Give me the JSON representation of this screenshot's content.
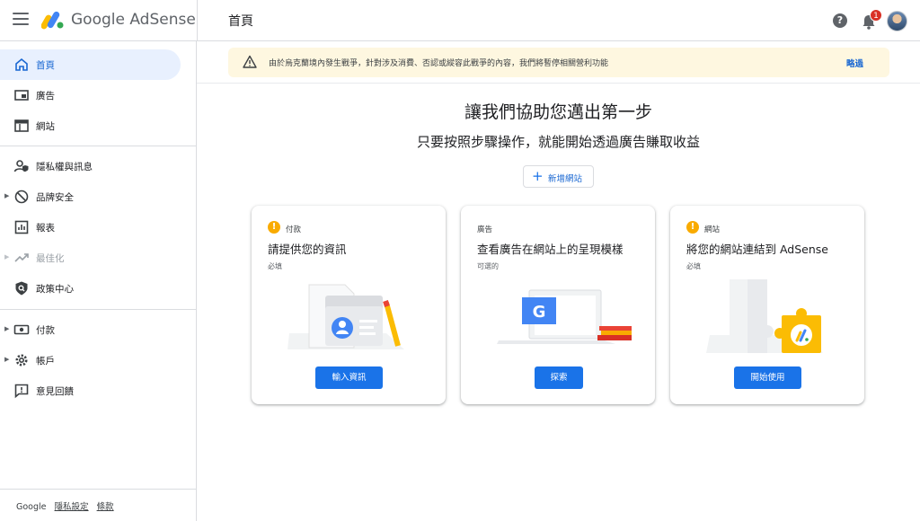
{
  "header": {
    "brand": "Google AdSense",
    "page_title": "首頁",
    "help_icon_glyph": "?",
    "notification_count": "1"
  },
  "sidebar": {
    "items": [
      {
        "label": "首頁",
        "icon": "home-icon",
        "active": true
      },
      {
        "label": "廣告",
        "icon": "ads-icon"
      },
      {
        "label": "網站",
        "icon": "sites-icon"
      },
      {
        "label": "隱私權與訊息",
        "icon": "privacy-messaging-icon"
      },
      {
        "label": "品牌安全",
        "icon": "block-icon"
      },
      {
        "label": "報表",
        "icon": "reports-icon"
      },
      {
        "label": "最佳化",
        "icon": "trending-up-icon",
        "disabled": true
      },
      {
        "label": "政策中心",
        "icon": "policy-shield-icon"
      },
      {
        "label": "付款",
        "icon": "payments-icon"
      },
      {
        "label": "帳戶",
        "icon": "gear-icon"
      },
      {
        "label": "意見回饋",
        "icon": "feedback-icon"
      }
    ],
    "footer": {
      "brand": "Google",
      "privacy": "隱私設定",
      "terms": "條款"
    }
  },
  "banner": {
    "icon": "warning-icon",
    "message": "由於烏克蘭境內發生戰爭，針對涉及消費、否認或縱容此戰爭的內容，我們將暫停相關營利功能",
    "dismiss_label": "略過"
  },
  "main": {
    "title": "讓我們協助您邁出第一步",
    "subtitle": "只要按照步驟操作，就能開始透過廣告賺取收益",
    "add_site_label": "新增網站",
    "add_site_icon": "+",
    "status_glyph": "!",
    "cards": [
      {
        "category": "付款",
        "title": "請提供您的資訊",
        "requirement": "必填",
        "button": "輸入資訊",
        "status": "warning"
      },
      {
        "category": "廣告",
        "title": "查看廣告在網站上的呈現模樣",
        "requirement": "可選的",
        "button": "探索",
        "status": "none"
      },
      {
        "category": "網站",
        "title": "將您的網站連結到 AdSense",
        "requirement": "必填",
        "button": "開始使用",
        "status": "warning"
      }
    ]
  },
  "colors": {
    "accent": "#1a73e8",
    "warning": "#f9ab00",
    "badge": "#d93025",
    "banner_bg": "#fef7e0",
    "active_nav_bg": "#e8f0fe"
  }
}
